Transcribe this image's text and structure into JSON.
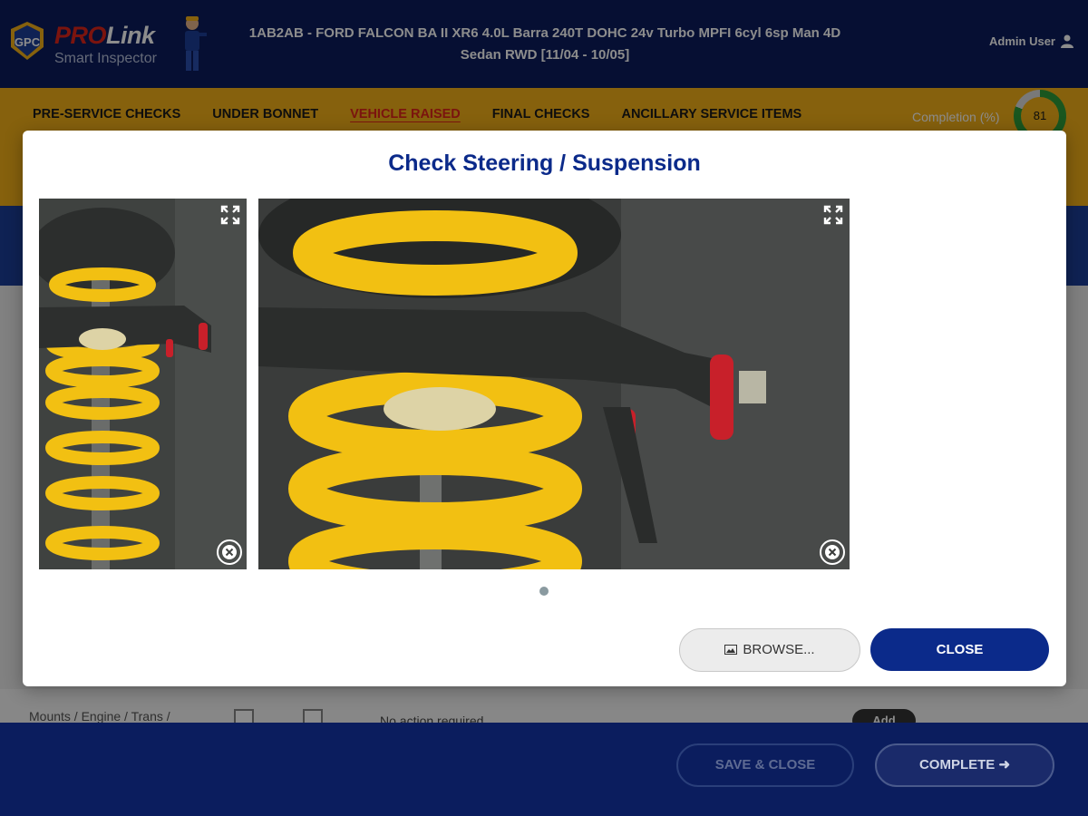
{
  "header": {
    "logo_text": "GPC",
    "brand_pro": "PRO",
    "brand_link": "Link",
    "brand_sub": "Smart Inspector",
    "vehicle_title_line1": "1AB2AB - FORD FALCON BA II XR6 4.0L Barra 240T DOHC 24v Turbo MPFI 6cyl 6sp Man 4D",
    "vehicle_title_line2": "Sedan RWD [11/04 - 10/05]",
    "user": "Admin User",
    "user_icon": "person-icon"
  },
  "nav": {
    "tabs": [
      {
        "label": "PRE-SERVICE CHECKS",
        "active": false
      },
      {
        "label": "UNDER BONNET",
        "active": false
      },
      {
        "label": "VEHICLE RAISED",
        "active": true
      },
      {
        "label": "FINAL CHECKS",
        "active": false
      },
      {
        "label": "ANCILLARY SERVICE ITEMS",
        "active": false
      }
    ],
    "completion_label": "Completion (%)",
    "completion_value": "81",
    "completion_fraction": 0.81
  },
  "background": {
    "row_label": "Mounts / Engine / Trans /",
    "note": "No action required",
    "add_label": "Add"
  },
  "modal": {
    "title": "Check Steering / Suspension",
    "photos": [
      {
        "expand_icon": "expand-icon",
        "remove_icon": "remove-circle-icon"
      },
      {
        "expand_icon": "expand-icon",
        "remove_icon": "remove-circle-icon"
      }
    ],
    "browse_label": "BROWSE...",
    "browse_icon": "image-icon",
    "close_label": "CLOSE"
  },
  "footer": {
    "save_close_label": "SAVE & CLOSE",
    "complete_label": "COMPLETE"
  },
  "colors": {
    "navy": "#0b1d5e",
    "amber": "#f4b119",
    "accent_red": "#e1251b",
    "progress_green": "#2e9d3a",
    "modal_title": "#0b2a8a"
  }
}
